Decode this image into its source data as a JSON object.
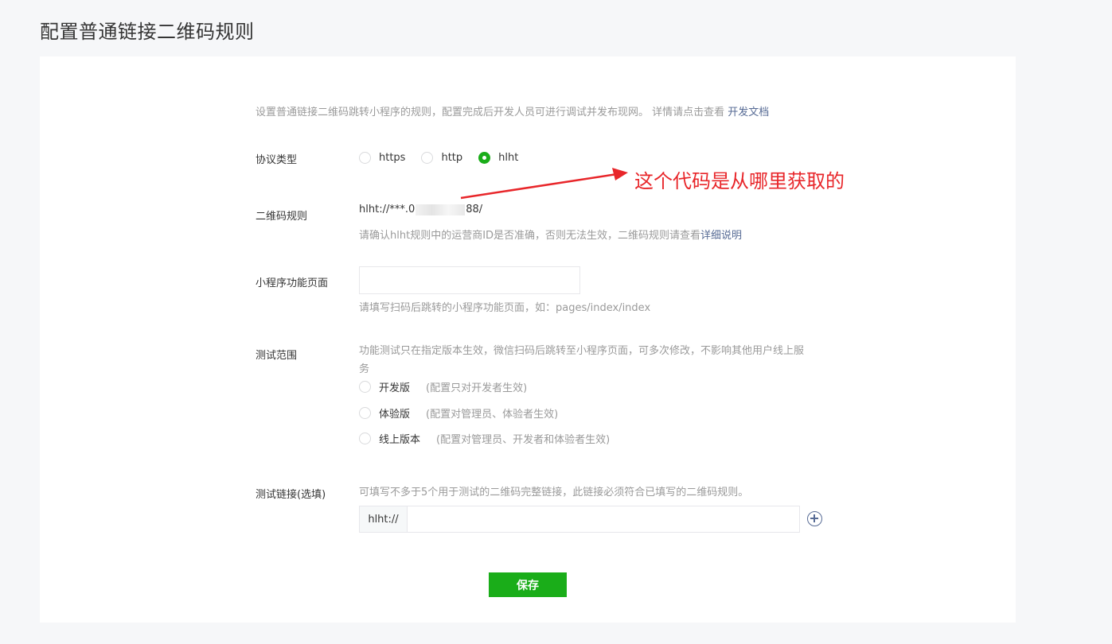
{
  "page": {
    "title": "配置普通链接二维码规则"
  },
  "intro": {
    "text": "设置普通链接二维码跳转小程序的规则，配置完成后开发人员可进行调试并发布现网。 详情请点击查看 ",
    "link": "开发文档"
  },
  "protocol": {
    "label": "协议类型",
    "options": [
      "https",
      "http",
      "hlht"
    ],
    "selected": "hlht"
  },
  "qr_rule": {
    "label": "二维码规则",
    "value_prefix": "hlht://***.0",
    "value_suffix": "88/",
    "hint": "请确认hlht规则中的运营商ID是否准确，否则无法生效，二维码规则请查看",
    "hint_link": "详细说明"
  },
  "mini_page": {
    "label": "小程序功能页面",
    "value": "",
    "hint": "请填写扫码后跳转的小程序功能页面，如：pages/index/index"
  },
  "test_scope": {
    "label": "测试范围",
    "description": "功能测试只在指定版本生效，微信扫码后跳转至小程序页面，可多次修改，不影响其他用户线上服务",
    "options": [
      {
        "label": "开发版",
        "note": "(配置只对开发者生效)"
      },
      {
        "label": "体验版",
        "note": "(配置对管理员、体验者生效)"
      },
      {
        "label": "线上版本",
        "note": "(配置对管理员、开发者和体验者生效)"
      }
    ]
  },
  "test_links": {
    "label": "测试链接(选填)",
    "hint": "可填写不多于5个用于测试的二维码完整链接，此链接必须符合已填写的二维码规则。",
    "prefix": "hlht://",
    "value": ""
  },
  "save": {
    "label": "保存"
  },
  "annotation": {
    "text": "这个代码是从哪里获取的",
    "color": "#e8262a"
  },
  "colors": {
    "primary": "#1aad19",
    "link": "#576b95"
  }
}
